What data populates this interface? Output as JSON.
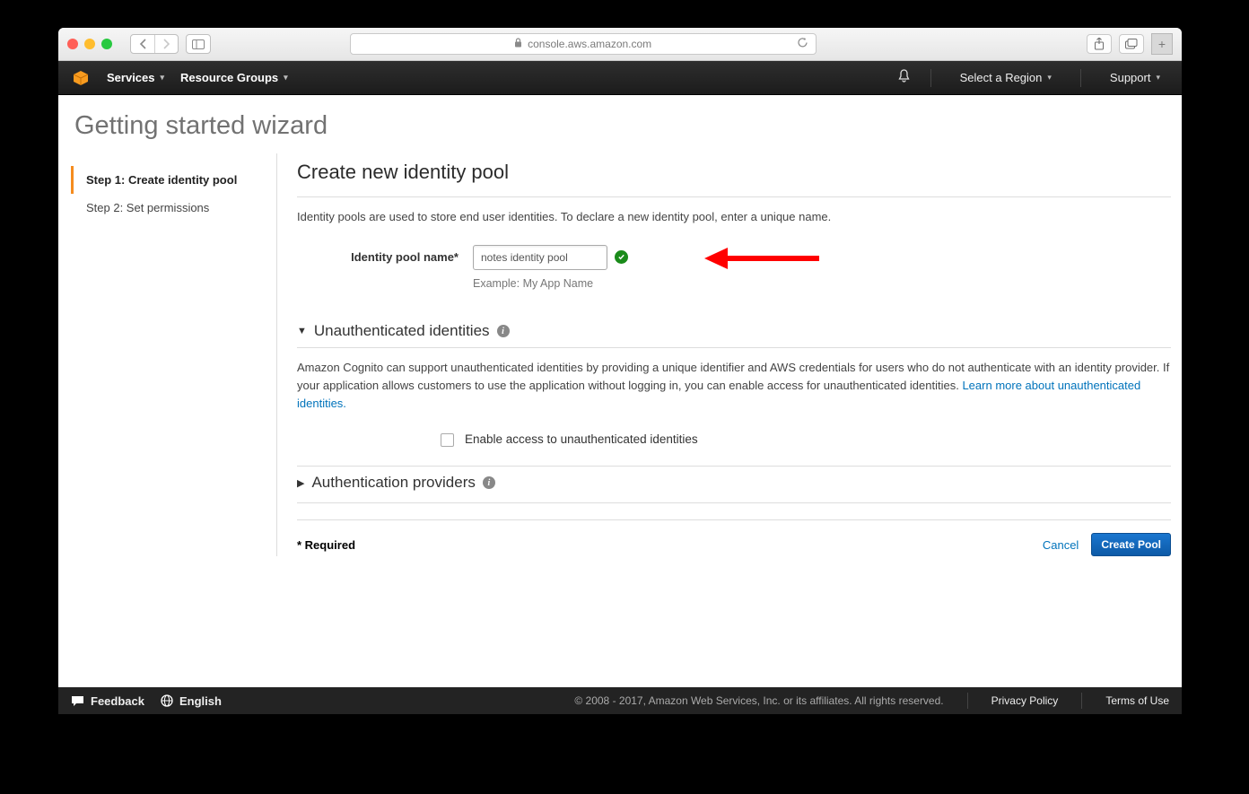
{
  "browser": {
    "url": "console.aws.amazon.com"
  },
  "aws_nav": {
    "services": "Services",
    "resource_groups": "Resource Groups",
    "region": "Select a Region",
    "support": "Support"
  },
  "page": {
    "title": "Getting started wizard"
  },
  "wizard_steps": {
    "step1": "Step 1: Create identity pool",
    "step2": "Step 2: Set permissions"
  },
  "main": {
    "heading": "Create new identity pool",
    "description": "Identity pools are used to store end user identities. To declare a new identity pool, enter a unique name.",
    "form": {
      "label": "Identity pool name*",
      "value": "notes identity pool",
      "example": "Example: My App Name"
    },
    "unauth": {
      "heading": "Unauthenticated identities",
      "body_pre": "Amazon Cognito can support unauthenticated identities by providing a unique identifier and AWS credentials for users who do not authenticate with an identity provider. If your application allows customers to use the application without logging in, you can enable access for unauthenticated identities. ",
      "link": "Learn more about unauthenticated identities.",
      "checkbox_label": "Enable access to unauthenticated identities"
    },
    "auth_providers": {
      "heading": "Authentication providers"
    },
    "required_note": "* Required",
    "cancel": "Cancel",
    "create": "Create Pool"
  },
  "footer": {
    "feedback": "Feedback",
    "language": "English",
    "copyright": "© 2008 - 2017, Amazon Web Services, Inc. or its affiliates. All rights reserved.",
    "privacy": "Privacy Policy",
    "terms": "Terms of Use"
  }
}
